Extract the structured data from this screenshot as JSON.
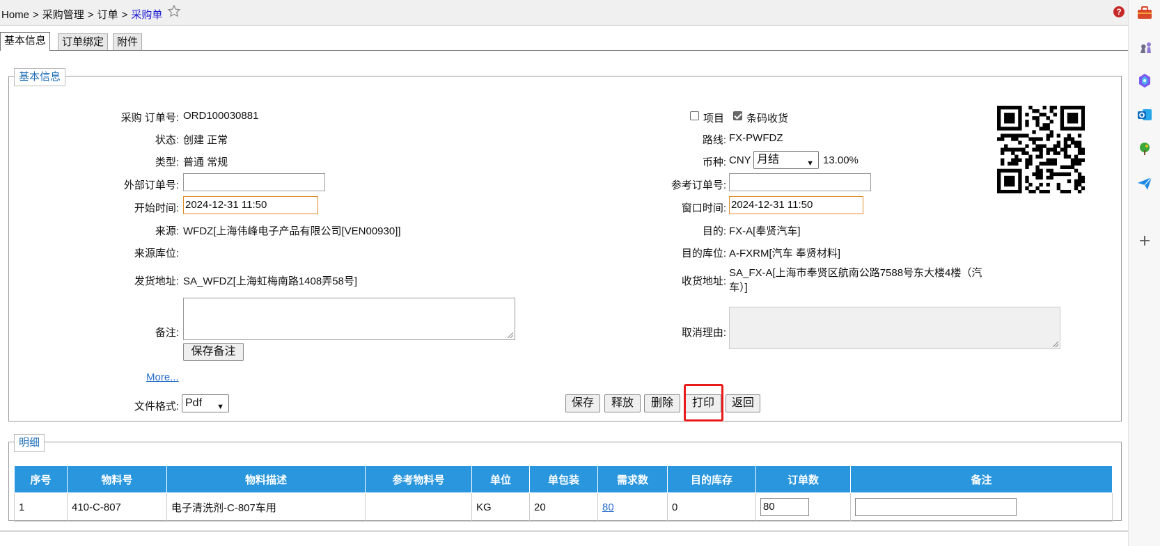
{
  "breadcrumb": {
    "home": "Home",
    "sep": ">",
    "level1": "采购管理",
    "level2": "订单",
    "current": "采购单"
  },
  "tabs": [
    "基本信息",
    "订单绑定",
    "附件"
  ],
  "basic": {
    "legend": "基本信息",
    "order_no_label": "采购 订单号:",
    "order_no": "ORD100030881",
    "status_label": "状态:",
    "status": "创建 正常",
    "type_label": "类型:",
    "type": "普通 常规",
    "ext_order_label": "外部订单号:",
    "ext_order": "",
    "start_time_label": "开始时间:",
    "start_time": "2024-12-31 11:50",
    "source_label": "来源:",
    "source": "WFDZ[上海伟峰电子产品有限公司[VEN00930]]",
    "source_loc_label": "来源库位:",
    "source_loc": "",
    "ship_addr_label": "发货地址:",
    "ship_addr": "SA_WFDZ[上海虹梅南路1408弄58号]",
    "remark_label": "备注:",
    "remark": "",
    "save_remark": "保存备注",
    "more": "More...",
    "format_label": "文件格式:",
    "format": "Pdf",
    "project_label": "项目",
    "project_checked": false,
    "barcode_label": "条码收货",
    "barcode_checked": true,
    "route_label": "路线:",
    "route": "FX-PWFDZ",
    "currency_label": "币种:",
    "currency": "CNY",
    "settle": "月结",
    "rate": "13.00%",
    "ref_order_label": "参考订单号:",
    "ref_order": "",
    "window_time_label": "窗口时间:",
    "window_time": "2024-12-31 11:50",
    "dest_label": "目的:",
    "dest": "FX-A[奉贤汽车]",
    "dest_loc_label": "目的库位:",
    "dest_loc": "A-FXRM[汽车 奉贤材料]",
    "recv_addr_label": "收货地址:",
    "recv_addr": "SA_FX-A[上海市奉贤区航南公路7588号东大楼4楼（汽车）]",
    "cancel_reason_label": "取消理由:",
    "cancel_reason": ""
  },
  "actions": {
    "save": "保存",
    "release": "释放",
    "delete": "删除",
    "print": "打印",
    "back": "返回"
  },
  "detail": {
    "legend": "明细",
    "columns": [
      "序号",
      "物料号",
      "物料描述",
      "参考物料号",
      "单位",
      "单包装",
      "需求数",
      "目的库存",
      "订单数",
      "备注"
    ],
    "rows": [
      {
        "seq": "1",
        "material": "410-C-807",
        "desc": "电子清洗剂-C-807车用",
        "ref": "",
        "unit": "KG",
        "pack": "20",
        "demand": "80",
        "stock": "0",
        "order_qty": "80",
        "remark": ""
      }
    ]
  },
  "icons": [
    "star-icon",
    "help-icon",
    "toolbox-icon",
    "chess-icon",
    "copilot-icon",
    "outlook-icon",
    "tree-icon",
    "send-icon",
    "add-icon"
  ],
  "colors": {
    "header_blue": "#2996de",
    "link": "#2a6fc9",
    "highlight": "#e81a1a",
    "date_border": "#e08a2c"
  }
}
